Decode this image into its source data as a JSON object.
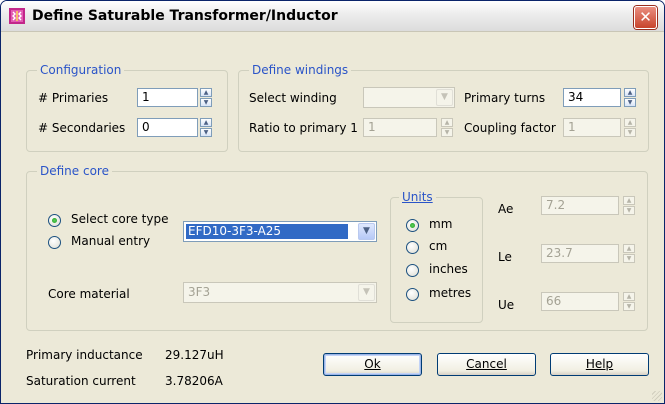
{
  "window": {
    "title": "Define Saturable Transformer/Inductor",
    "close": "✕"
  },
  "configuration": {
    "legend": "Configuration",
    "primaries_label": "# Primaries",
    "primaries_value": "1",
    "secondaries_label": "# Secondaries",
    "secondaries_value": "0"
  },
  "windings": {
    "legend": "Define windings",
    "select_winding_label": "Select winding",
    "select_winding_value": "",
    "primary_turns_label": "Primary turns",
    "primary_turns_value": "34",
    "ratio_label": "Ratio to primary 1",
    "ratio_value": "1",
    "coupling_label": "Coupling factor",
    "coupling_value": "1"
  },
  "core": {
    "legend": "Define core",
    "select_core_type_label": "Select core type",
    "manual_entry_label": "Manual entry",
    "core_type_value": "EFD10-3F3-A25",
    "core_material_label": "Core material",
    "core_material_value": "3F3",
    "units": {
      "legend": "Units",
      "options": [
        "mm",
        "cm",
        "inches",
        "metres"
      ],
      "selected": "mm"
    },
    "ae_label": "Ae",
    "ae_value": "7.2",
    "le_label": "Le",
    "le_value": "23.7",
    "ue_label": "Ue",
    "ue_value": "66"
  },
  "results": {
    "primary_inductance_label": "Primary inductance",
    "primary_inductance_value": "29.127uH",
    "saturation_current_label": "Saturation current",
    "saturation_current_value": "3.78206A"
  },
  "buttons": {
    "ok": "Ok",
    "cancel": "Cancel",
    "help": "Help"
  },
  "colors": {
    "legend_text": "#2a54c8",
    "face": "#ece9d8",
    "selection": "#316ac5"
  }
}
